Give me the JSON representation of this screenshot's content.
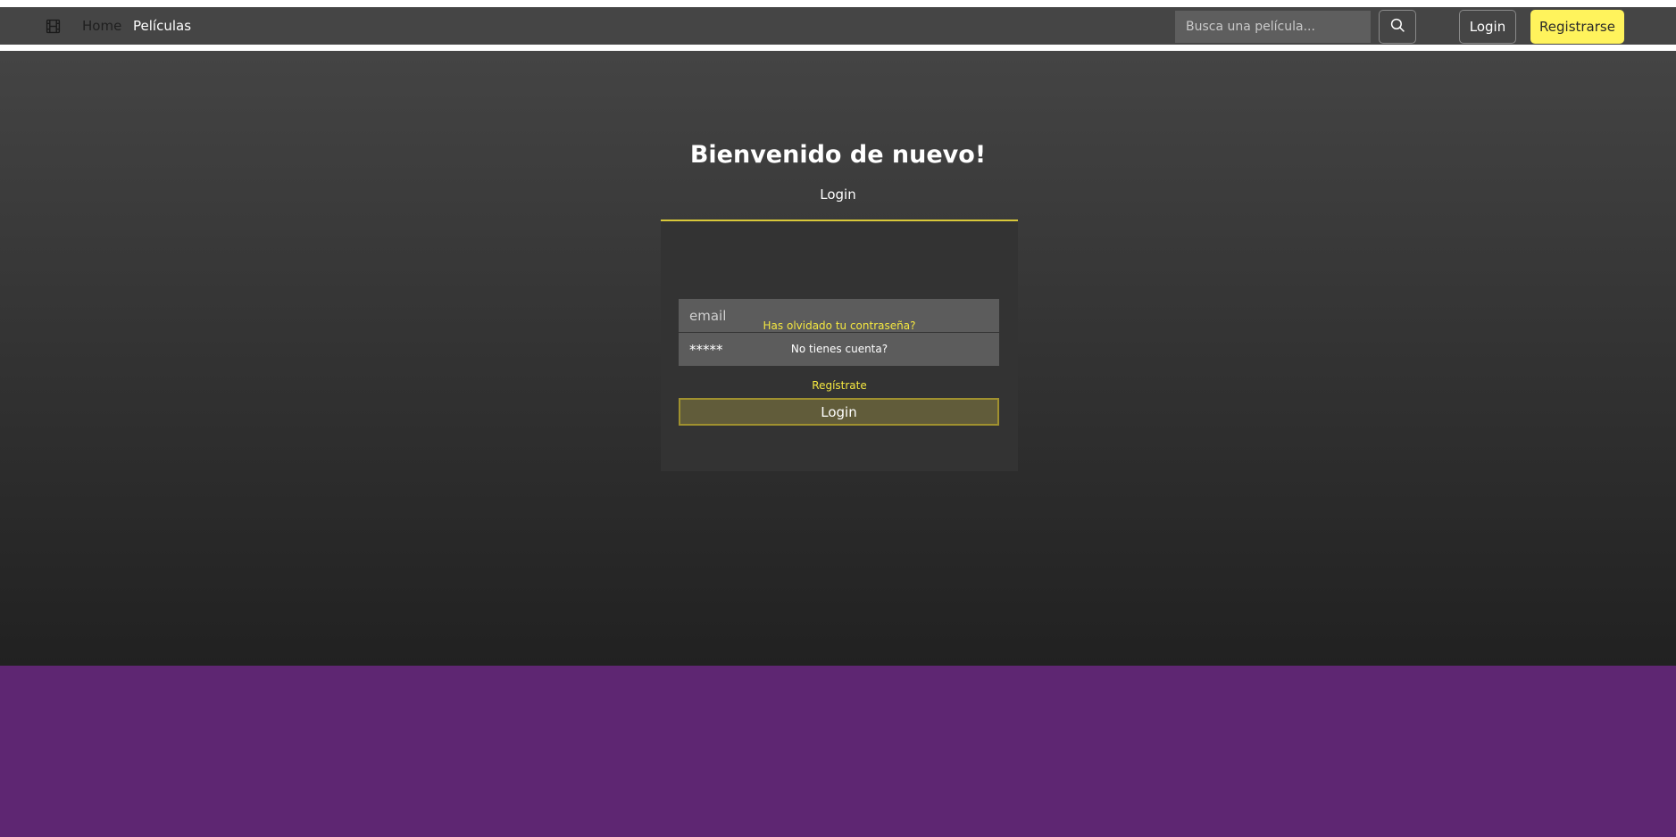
{
  "colors": {
    "navbar_bg": "#454545",
    "accent_yellow": "#fff35c",
    "footer_purple": "#5e2672",
    "card_bg": "#333333"
  },
  "navbar": {
    "brand_icon": "film-icon",
    "links": [
      {
        "label": "Home"
      },
      {
        "label": "Películas"
      }
    ],
    "search": {
      "placeholder": "Busca una película...",
      "button_icon": "search-icon"
    },
    "login_label": "Login",
    "register_label": "Registrarse"
  },
  "main": {
    "title": "Bienvenido de nuevo!",
    "subtitle": "Login",
    "form": {
      "email_placeholder": "email",
      "password_value": "*****",
      "forgot_label": "Has olvidado tu contraseña?",
      "no_account_label": "No tienes cuenta?",
      "register_label": "Regístrate",
      "submit_label": "Login"
    }
  }
}
